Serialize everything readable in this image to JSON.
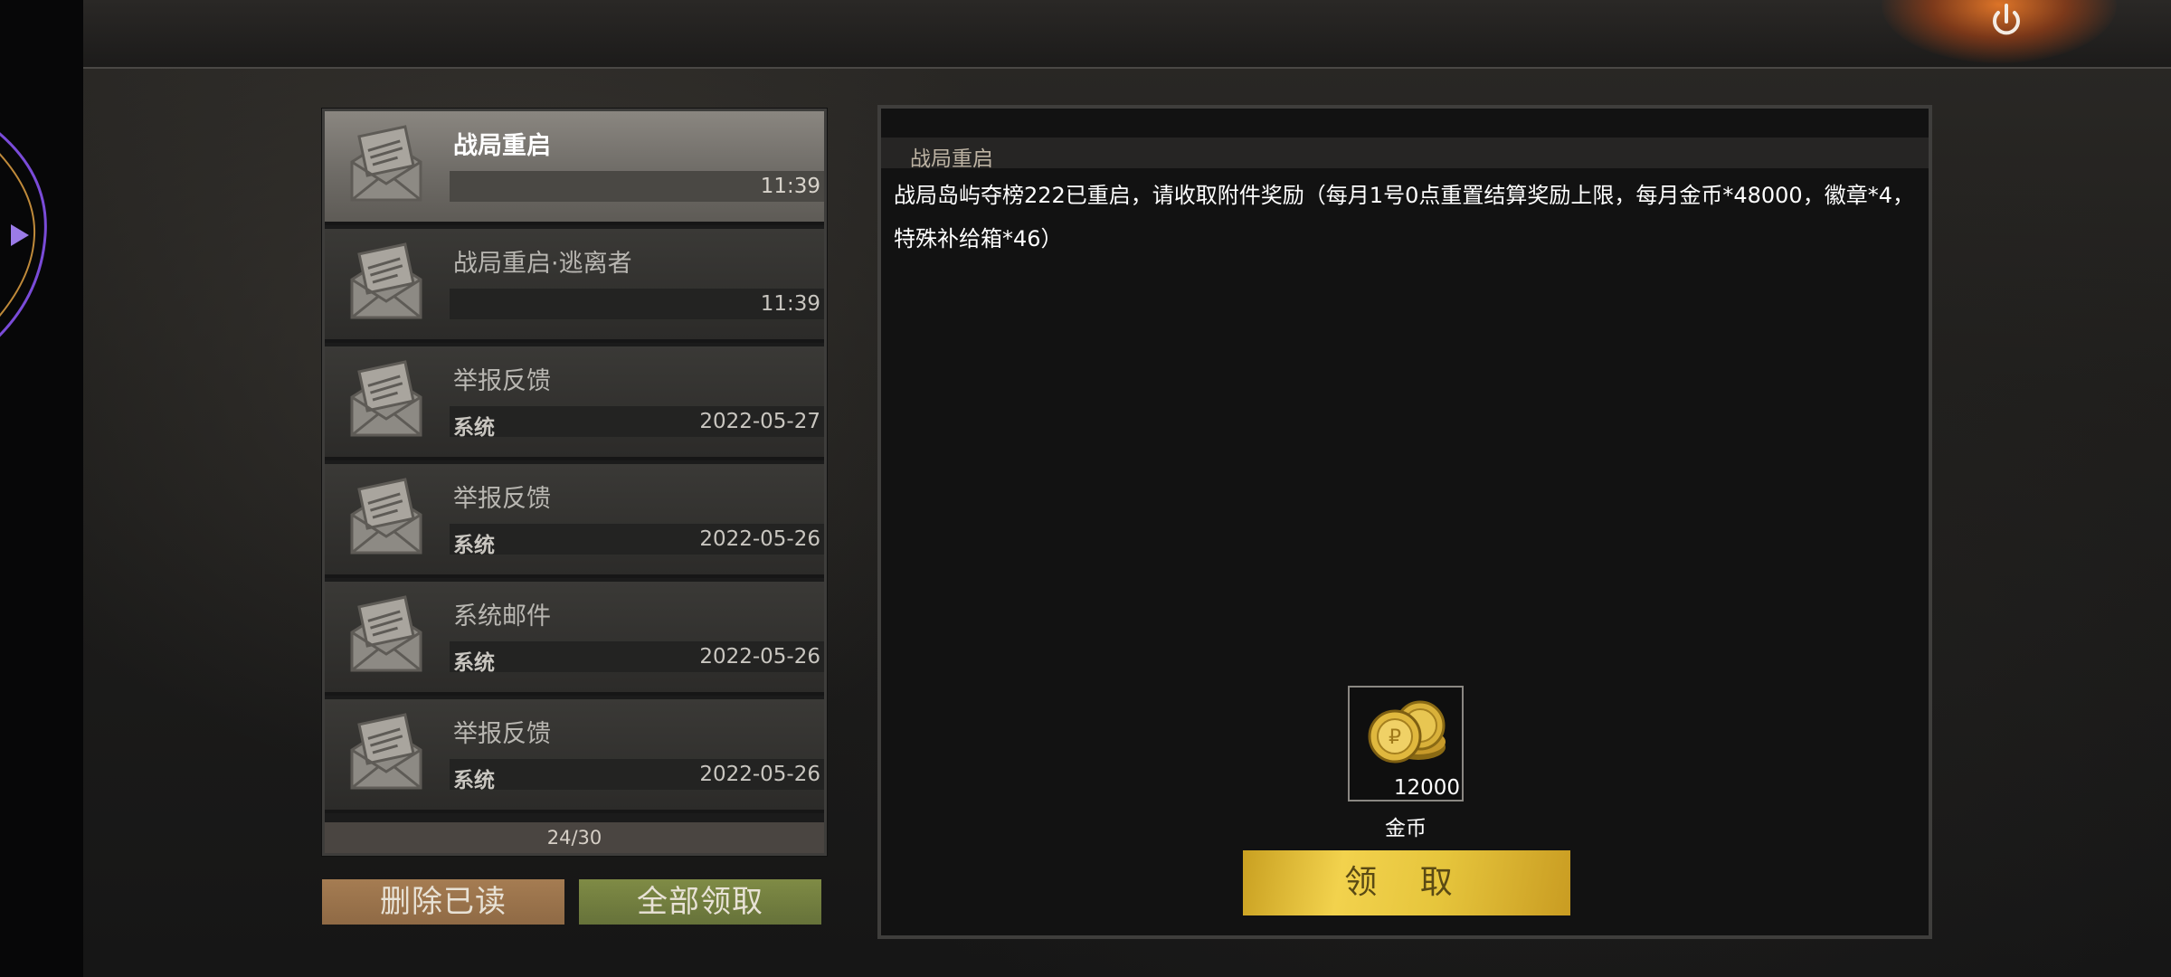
{
  "mail_list": {
    "items": [
      {
        "title": "战局重启",
        "sender": "",
        "time": "11:39",
        "active": true
      },
      {
        "title": "战局重启·逃离者",
        "sender": "",
        "time": "11:39",
        "active": false
      },
      {
        "title": "举报反馈",
        "sender": "系统",
        "time": "2022-05-27",
        "active": false
      },
      {
        "title": "举报反馈",
        "sender": "系统",
        "time": "2022-05-26",
        "active": false
      },
      {
        "title": "系统邮件",
        "sender": "系统",
        "time": "2022-05-26",
        "active": false
      },
      {
        "title": "举报反馈",
        "sender": "系统",
        "time": "2022-05-26",
        "active": false
      }
    ],
    "pager": "24/30"
  },
  "actions": {
    "delete_read_label": "删除已读",
    "claim_all_label": "全部领取"
  },
  "detail": {
    "title": "战局重启",
    "body": "战局岛屿夺榜222已重启，请收取附件奖励（每月1号0点重置结算奖励上限，每月金币*48000，徽章*4，特殊补给箱*46）",
    "reward": {
      "quantity": "12000",
      "name": "金币",
      "icon": "gold-coin-icon"
    },
    "claim_label": "领 取"
  },
  "top_bar": {
    "icon": "power-icon"
  },
  "colors": {
    "active_item": "#7a7671",
    "claim_button": "#f2d24d",
    "delete_button": "#a57c52",
    "claim_all_button": "#7f8b45"
  }
}
